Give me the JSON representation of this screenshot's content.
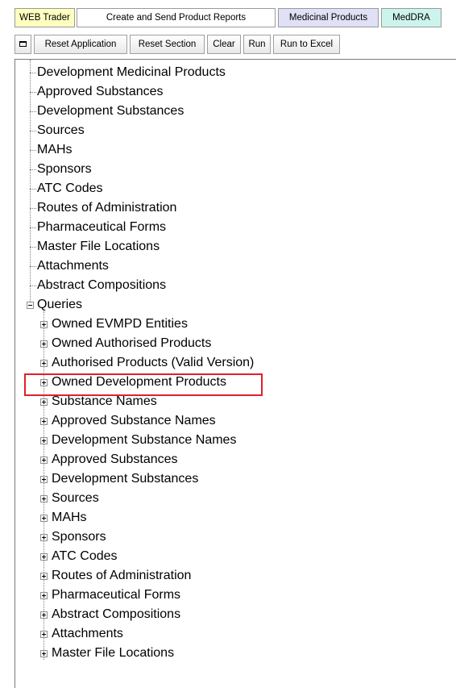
{
  "tabs": [
    {
      "label": "WEB Trader"
    },
    {
      "label": "Create and Send Product Reports"
    },
    {
      "label": "Medicinal Products"
    },
    {
      "label": "MedDRA"
    }
  ],
  "toolbar": {
    "menu_icon": "window-icon",
    "buttons": [
      {
        "label": "Reset Application"
      },
      {
        "label": "Reset Section"
      },
      {
        "label": "Clear"
      },
      {
        "label": "Run"
      },
      {
        "label": "Run to Excel"
      }
    ]
  },
  "tree": {
    "items": [
      "Development Medicinal Products",
      "Approved Substances",
      "Development Substances",
      "Sources",
      "MAHs",
      "Sponsors",
      "ATC Codes",
      "Routes of Administration",
      "Pharmaceutical Forms",
      "Master File Locations",
      "Attachments",
      "Abstract Compositions"
    ],
    "queries_label": "Queries",
    "queries": [
      "Owned EVMPD Entities",
      "Owned Authorised Products",
      "Authorised Products (Valid Version)",
      "Owned Development Products",
      "Substance Names",
      "Approved Substance Names",
      "Development Substance Names",
      "Approved Substances",
      "Development Substances",
      "Sources",
      "MAHs",
      "Sponsors",
      "ATC Codes",
      "Routes of Administration",
      "Pharmaceutical Forms",
      "Abstract Compositions",
      "Attachments",
      "Master File Locations"
    ]
  },
  "colors": {
    "tab_web_trader": "#ffffc0",
    "tab_reports": "#ffffff",
    "tab_medicinal": "#e0e0f6",
    "tab_meddra": "#ccf4ec",
    "highlight": "#e0202a"
  }
}
